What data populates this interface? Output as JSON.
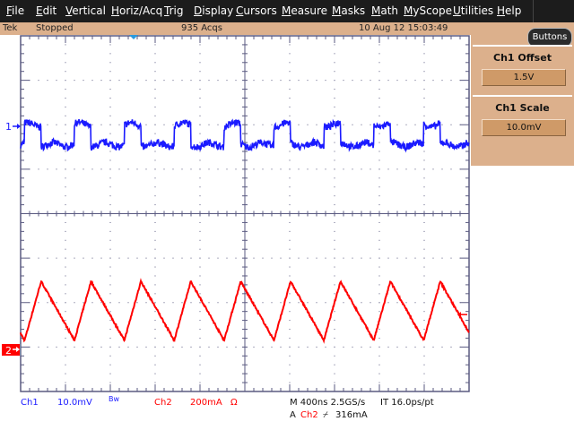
{
  "menu": [
    "File",
    "Edit",
    "Vertical",
    "Horiz/Acq",
    "Trig",
    "Display",
    "Cursors",
    "Measure",
    "Masks",
    "Math",
    "MyScope",
    "Utilities",
    "Help"
  ],
  "status": {
    "brand": "Tek",
    "state": "Stopped",
    "acqs": "935 Acqs",
    "datetime": "10 Aug 12 15:03:49"
  },
  "side": {
    "buttons_label": "Buttons",
    "panels": [
      {
        "title": "Ch1 Offset",
        "value": "1.5V"
      },
      {
        "title": "Ch1 Scale",
        "value": "10.0mV"
      }
    ]
  },
  "markers": {
    "ch1": "1",
    "ch2": "2"
  },
  "readout": {
    "ch1_label": "Ch1",
    "ch1_scale": "10.0mV",
    "ch1_bw": "Bw",
    "ch2_label": "Ch2",
    "ch2_scale": "200mA",
    "ch2_term": "Ω",
    "horiz": "M 400ns 2.5GS/s",
    "interp": "IT 16.0ps/pt",
    "trig_prefix": "A",
    "trig_src": "Ch2",
    "trig_slope": "⌿",
    "trig_level": "316mA"
  },
  "colors": {
    "ch1": "#1a1aff",
    "ch2": "#ff0000",
    "graticule": "#5a5a80",
    "status_bg": "#dcb08c",
    "menu_bg": "#1c1c1c"
  },
  "chart_data": {
    "type": "line",
    "x_unit": "ns",
    "xlim": [
      0,
      4000
    ],
    "x_per_div": 400,
    "x_divisions": 10,
    "y_divisions": 8,
    "grid": true,
    "series": [
      {
        "name": "Ch1",
        "unit": "mV",
        "per_div": 10,
        "ref_div": 2,
        "shape": "pulse",
        "period_ns": 445,
        "first_rise_ns": 35,
        "high_duration_ns": 148,
        "high": 0,
        "low": -4.5
      },
      {
        "name": "Ch2",
        "unit": "mA",
        "per_div": 200,
        "ref_div": 7,
        "shape": "triangle",
        "period_ns": 445,
        "first_trough_ns": 35,
        "rise_duration_ns": 148,
        "min": 200,
        "max": 465
      }
    ],
    "trigger": {
      "source": "Ch2",
      "level_mA": 316,
      "slope": "rising"
    }
  }
}
